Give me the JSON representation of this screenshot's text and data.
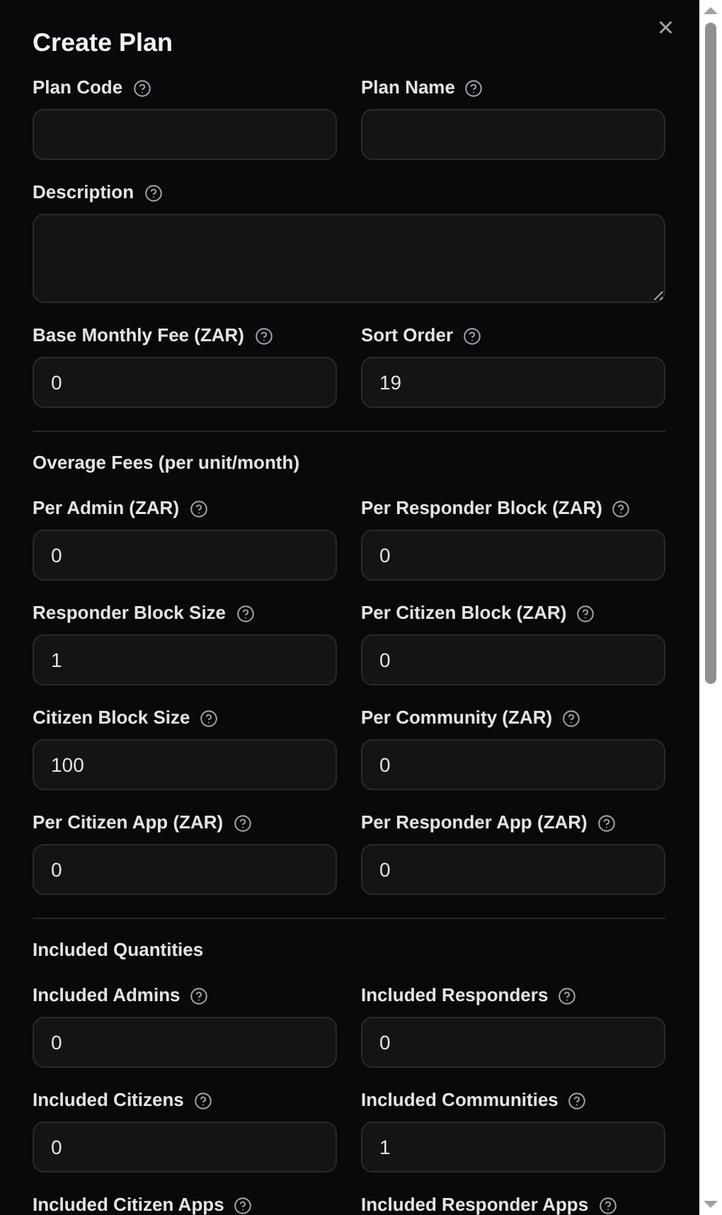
{
  "dialog": {
    "title": "Create Plan",
    "close": "×"
  },
  "sections": [
    {
      "fields": [
        {
          "label": "Plan Code",
          "kind": "input"
        },
        {
          "label": "Plan Name",
          "kind": "input"
        },
        {
          "label": "Description",
          "kind": "textarea"
        },
        {
          "label": "Base Monthly Fee (ZAR)",
          "kind": "input",
          "value": "0"
        },
        {
          "label": "Sort Order",
          "kind": "input",
          "value": "19"
        }
      ]
    },
    {
      "heading": "Overage Fees (per unit/month)",
      "fields": [
        {
          "label": "Per Admin (ZAR)",
          "kind": "input",
          "value": "0"
        },
        {
          "label": "Per Responder Block (ZAR)",
          "kind": "input",
          "value": "0"
        },
        {
          "label": "Responder Block Size",
          "kind": "input",
          "value": "1"
        },
        {
          "label": "Per Citizen Block (ZAR)",
          "kind": "input",
          "value": "0"
        },
        {
          "label": "Citizen Block Size",
          "kind": "input",
          "value": "100"
        },
        {
          "label": "Per Community (ZAR)",
          "kind": "input",
          "value": "0"
        },
        {
          "label": "Per Citizen App (ZAR)",
          "kind": "input",
          "value": "0"
        },
        {
          "label": "Per Responder App (ZAR)",
          "kind": "input",
          "value": "0"
        }
      ]
    },
    {
      "heading": "Included Quantities",
      "fields": [
        {
          "label": "Included Admins",
          "kind": "input",
          "value": "0"
        },
        {
          "label": "Included Responders",
          "kind": "input",
          "value": "0"
        },
        {
          "label": "Included Citizens",
          "kind": "input",
          "value": "0"
        },
        {
          "label": "Included Communities",
          "kind": "input",
          "value": "1"
        },
        {
          "label": "Included Citizen Apps",
          "kind": "label-only"
        },
        {
          "label": "Included Responder Apps",
          "kind": "label-only"
        }
      ]
    }
  ]
}
